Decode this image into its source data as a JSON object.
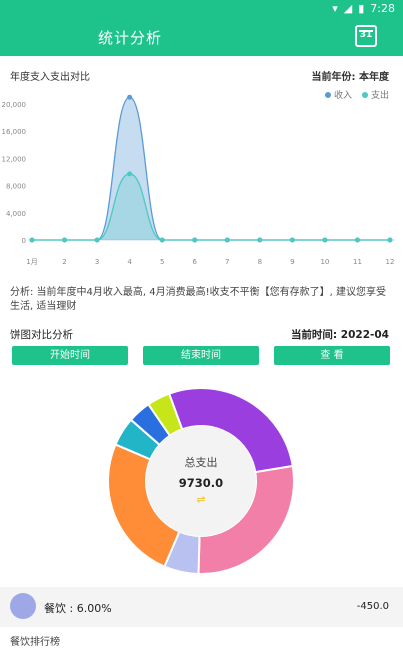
{
  "status": {
    "time": "7:28"
  },
  "app": {
    "title": "统计分析",
    "calendar_day": "31"
  },
  "line_section": {
    "title": "年度支入支出对比",
    "year_label": "当前年份: 本年度"
  },
  "chart_data": {
    "type": "line",
    "x": [
      "1月",
      "2",
      "3",
      "4",
      "5",
      "6",
      "7",
      "8",
      "9",
      "10",
      "11",
      "12"
    ],
    "ylim": [
      -2000,
      21000
    ],
    "yticks": [
      "0",
      "4,000",
      "8,000",
      "12,000",
      "16,000",
      "20,000"
    ],
    "series": [
      {
        "name": "收入",
        "color": "#5b9bd5",
        "values": [
          0,
          0,
          0,
          21000,
          0,
          0,
          0,
          0,
          0,
          0,
          0,
          0
        ]
      },
      {
        "name": "支出",
        "color": "#4cc9c4",
        "values": [
          0,
          0,
          0,
          9730,
          0,
          0,
          0,
          0,
          0,
          0,
          0,
          0
        ]
      }
    ],
    "legend_position": "top-right"
  },
  "analysis": {
    "text": "分析: 当前年度中4月收入最高, 4月消费最高!收支不平衡【您有存款了】, 建议您享受生活, 适当理财"
  },
  "pie_section": {
    "title": "饼图对比分析",
    "current_time": "当前时间: 2022-04",
    "buttons": {
      "start": "开始时间",
      "end": "结束时间",
      "view": "查 看"
    },
    "center_title": "总支出",
    "center_value": "9730.0",
    "segments": [
      {
        "color": "#9b3ee0",
        "value": 28
      },
      {
        "color": "#f27fa8",
        "value": 28
      },
      {
        "color": "#b8c1ef",
        "value": 6
      },
      {
        "color": "#ff8c36",
        "value": 25
      },
      {
        "color": "#22b5c8",
        "value": 5
      },
      {
        "color": "#2a6fe0",
        "value": 4
      },
      {
        "color": "#c6e61a",
        "value": 4
      }
    ]
  },
  "summary": {
    "label": "餐饮 : 6.00%",
    "amount": "-450.0"
  },
  "ranking": {
    "title": "餐饮排行榜"
  }
}
